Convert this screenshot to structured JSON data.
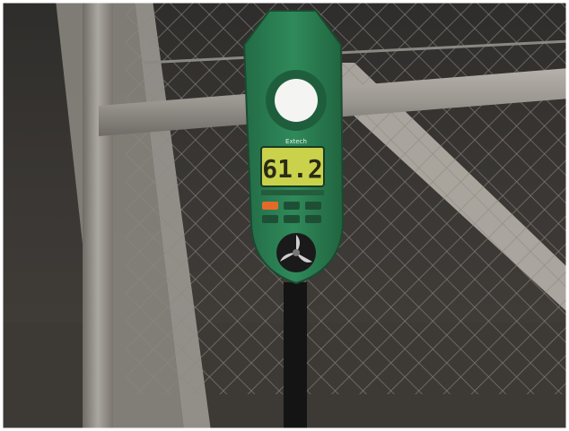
{
  "scene": {
    "meter_brand": "Extech",
    "meter_display_reading": "61.2"
  },
  "colors": {
    "background": "#3a3734",
    "fence_wire": "#8b8883",
    "pipe": "#9a9690",
    "meter_body": "#2f8a5a",
    "lcd": "#c9d24a",
    "sensor_dome": "#f4f4f2"
  }
}
